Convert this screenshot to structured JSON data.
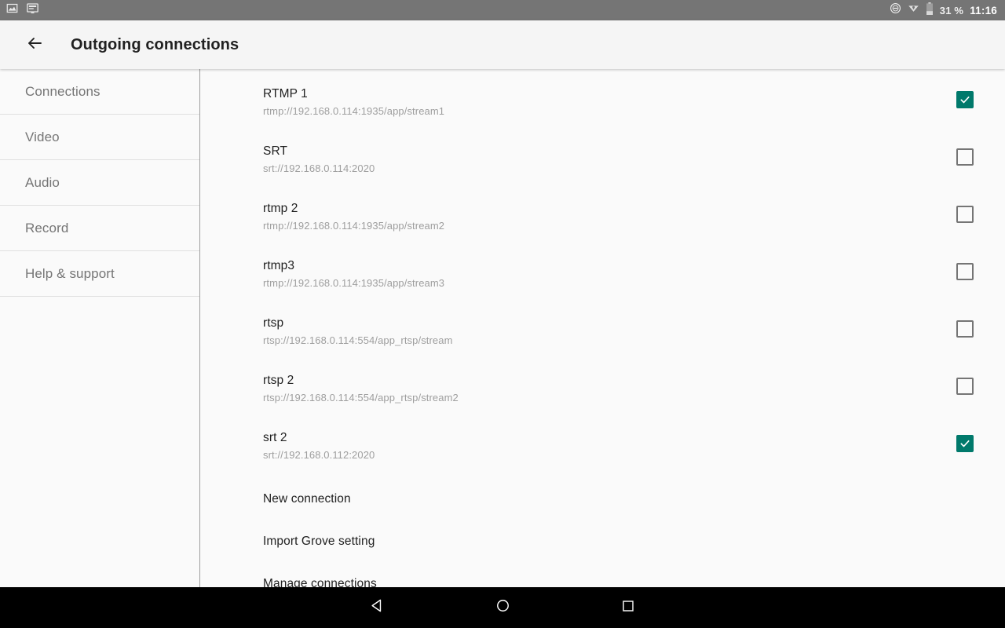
{
  "status_bar": {
    "notifications": [
      {
        "icon": "image-notification-icon"
      },
      {
        "icon": "screencast-notification-icon"
      }
    ],
    "dnd_icon": "do-not-disturb-icon",
    "vpn_icon": "vpn-key-icon",
    "battery_icon": "battery-icon",
    "battery_level": "31 %",
    "clock": "11:16"
  },
  "app_bar": {
    "back_icon": "back-arrow-icon",
    "title": "Outgoing connections"
  },
  "sidebar": {
    "items": [
      {
        "label": "Connections"
      },
      {
        "label": "Video"
      },
      {
        "label": "Audio"
      },
      {
        "label": "Record"
      },
      {
        "label": "Help & support"
      }
    ]
  },
  "connections": [
    {
      "name": "RTMP 1",
      "url": "rtmp://192.168.0.114:1935/app/stream1",
      "checked": true
    },
    {
      "name": "SRT",
      "url": "srt://192.168.0.114:2020",
      "checked": false
    },
    {
      "name": "rtmp 2",
      "url": "rtmp://192.168.0.114:1935/app/stream2",
      "checked": false
    },
    {
      "name": "rtmp3",
      "url": "rtmp://192.168.0.114:1935/app/stream3",
      "checked": false
    },
    {
      "name": "rtsp",
      "url": "rtsp://192.168.0.114:554/app_rtsp/stream",
      "checked": false
    },
    {
      "name": "rtsp 2",
      "url": "rtsp://192.168.0.114:554/app_rtsp/stream2",
      "checked": false
    },
    {
      "name": "srt 2",
      "url": "srt://192.168.0.112:2020",
      "checked": true
    }
  ],
  "actions": [
    {
      "label": "New connection"
    },
    {
      "label": "Import Grove setting"
    },
    {
      "label": "Manage connections"
    }
  ],
  "nav_bar": {
    "back_icon": "nav-back-triangle-icon",
    "home_icon": "nav-home-circle-icon",
    "recents_icon": "nav-recents-square-icon"
  },
  "colors": {
    "accent": "#00796b",
    "status_bar_bg": "#757575",
    "app_bar_bg": "#f5f5f5",
    "page_bg": "#fafafa",
    "nav_bar_bg": "#000000",
    "primary_text": "#212121",
    "secondary_text": "#9e9e9e",
    "sidebar_text": "#757575"
  }
}
